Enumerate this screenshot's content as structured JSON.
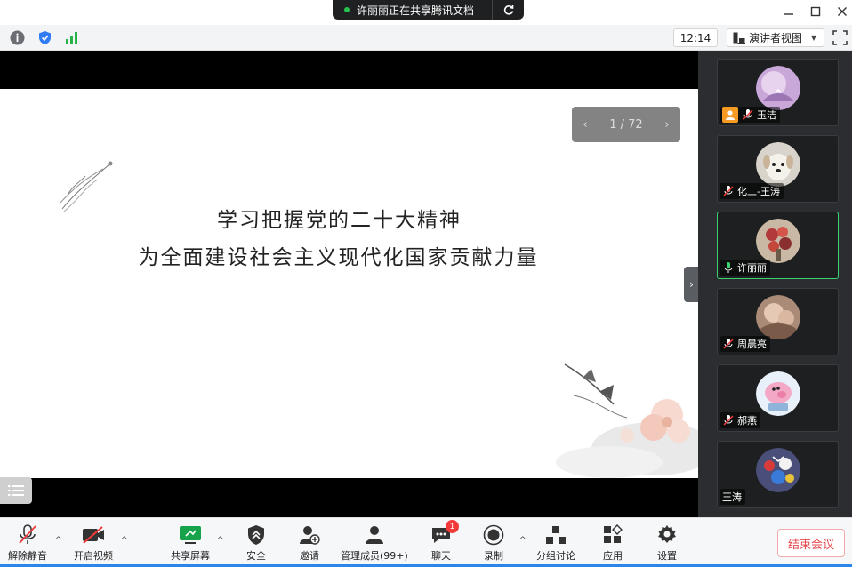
{
  "sharing_banner": {
    "text": "许丽丽正在共享腾讯文档"
  },
  "infobar": {
    "clock": "12:14",
    "view_label": "演讲者视图"
  },
  "slide": {
    "title_line1": "学习把握党的二十大精神",
    "title_line2": "为全面建设社会主义现代化国家贡献力量",
    "page_indicator": "1 / 72"
  },
  "participants": [
    {
      "name": "玉洁",
      "host": true,
      "muted": true
    },
    {
      "name": "化工-王涛",
      "host": false,
      "muted": true
    },
    {
      "name": "许丽丽",
      "host": false,
      "muted": false,
      "active": true
    },
    {
      "name": "周晨亮",
      "host": false,
      "muted": true
    },
    {
      "name": "郝燕",
      "host": false,
      "muted": true
    },
    {
      "name": "王涛",
      "host": false,
      "muted": null
    }
  ],
  "toolbar": {
    "unmute": "解除静音",
    "start_video": "开启视频",
    "share_screen": "共享屏幕",
    "security": "安全",
    "invite": "邀请",
    "manage_members": "管理成员(99+)",
    "chat": "聊天",
    "chat_badge": "1",
    "record": "录制",
    "breakout": "分组讨论",
    "apps": "应用",
    "settings": "设置",
    "end_meeting": "结束会议"
  },
  "colors": {
    "accent_green": "#3ad370",
    "end_red": "#e5484d",
    "host_orange": "#f59a23"
  }
}
